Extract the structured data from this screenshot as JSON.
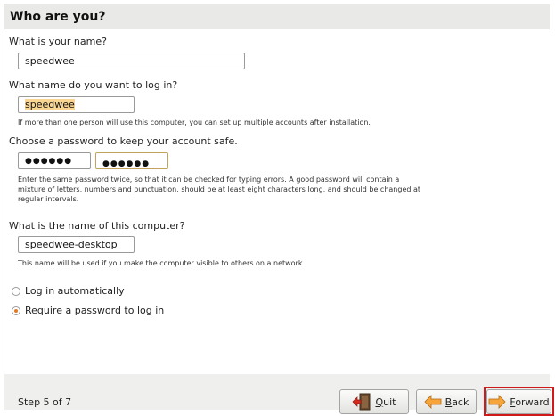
{
  "header": {
    "title": "Who are you?"
  },
  "name_section": {
    "label": "What is your name?",
    "value": "speedwee"
  },
  "login_section": {
    "label": "What name do you want to log in?",
    "value": "speedwee",
    "hint": "If more than one person will use this computer, you can set up multiple accounts after installation."
  },
  "password_section": {
    "label": "Choose a password to keep your account safe.",
    "password_mask": "●●●●●●",
    "confirm_mask": "●●●●●●",
    "hint_line1": "Enter the same password twice, so that it can be checked for typing errors. A good password will contain a",
    "hint_line2": "mixture of letters, numbers and punctuation, should be at least eight characters long, and should be changed at",
    "hint_line3": "regular intervals."
  },
  "computer_section": {
    "label": "What is the name of this computer?",
    "value": "speedwee-desktop",
    "hint": "This name will be used if you make the computer visible to others on a network."
  },
  "login_options": {
    "auto_label": "Log in automatically",
    "auto_selected": false,
    "password_label": "Require a password to log in",
    "password_selected": true
  },
  "footer": {
    "step": "Step 5 of 7",
    "quit_key": "Q",
    "quit_rest": "uit",
    "back_key": "B",
    "back_rest": "ack",
    "forward_key": "F",
    "forward_rest": "orward"
  },
  "icons": {
    "quit": "door-exit-icon",
    "back": "arrow-left-icon",
    "forward": "arrow-right-icon"
  },
  "colors": {
    "accent": "#e07b29",
    "selection": "#f8d692",
    "highlight": "#d01a1a"
  }
}
